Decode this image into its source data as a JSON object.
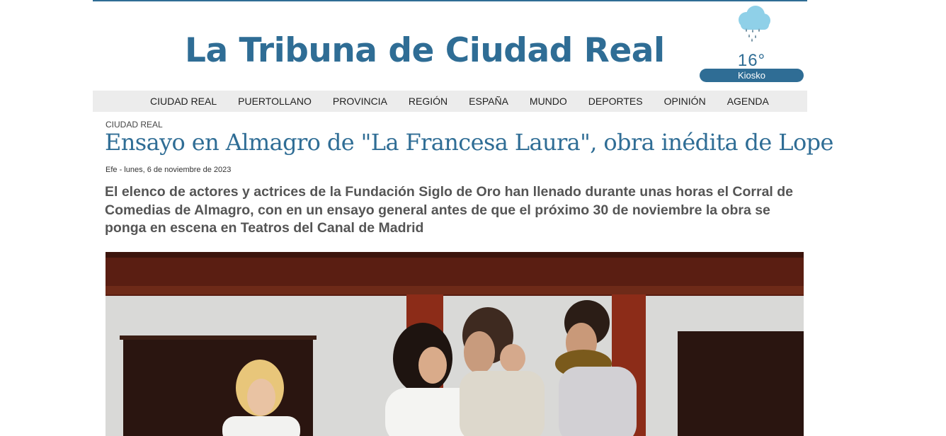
{
  "site": {
    "name": "La Tribuna de Ciudad Real",
    "brand_color": "#2f6d95"
  },
  "weather": {
    "icon": "rain-cloud-icon",
    "temperature": "16°",
    "kiosko_label": "Kiosko"
  },
  "nav": {
    "items": [
      {
        "label": "CIUDAD REAL"
      },
      {
        "label": "PUERTOLLANO"
      },
      {
        "label": "PROVINCIA"
      },
      {
        "label": "REGIÓN"
      },
      {
        "label": "ESPAÑA"
      },
      {
        "label": "MUNDO"
      },
      {
        "label": "DEPORTES"
      },
      {
        "label": "OPINIÓN"
      },
      {
        "label": "AGENDA"
      }
    ]
  },
  "article": {
    "section": "CIUDAD REAL",
    "title": "Ensayo en Almagro de \"La Francesa Laura\", obra inédita de Lope",
    "byline": "Efe - lunes, 6 de noviembre de 2023",
    "summary": "El elenco de actores y actrices de la Fundación Siglo de Oro han llenado durante unas horas el Corral de Comedias de Almagro, con en un ensayo general antes de que el próximo 30 de noviembre la obra se ponga en escena en Teatros del Canal de Madrid"
  }
}
